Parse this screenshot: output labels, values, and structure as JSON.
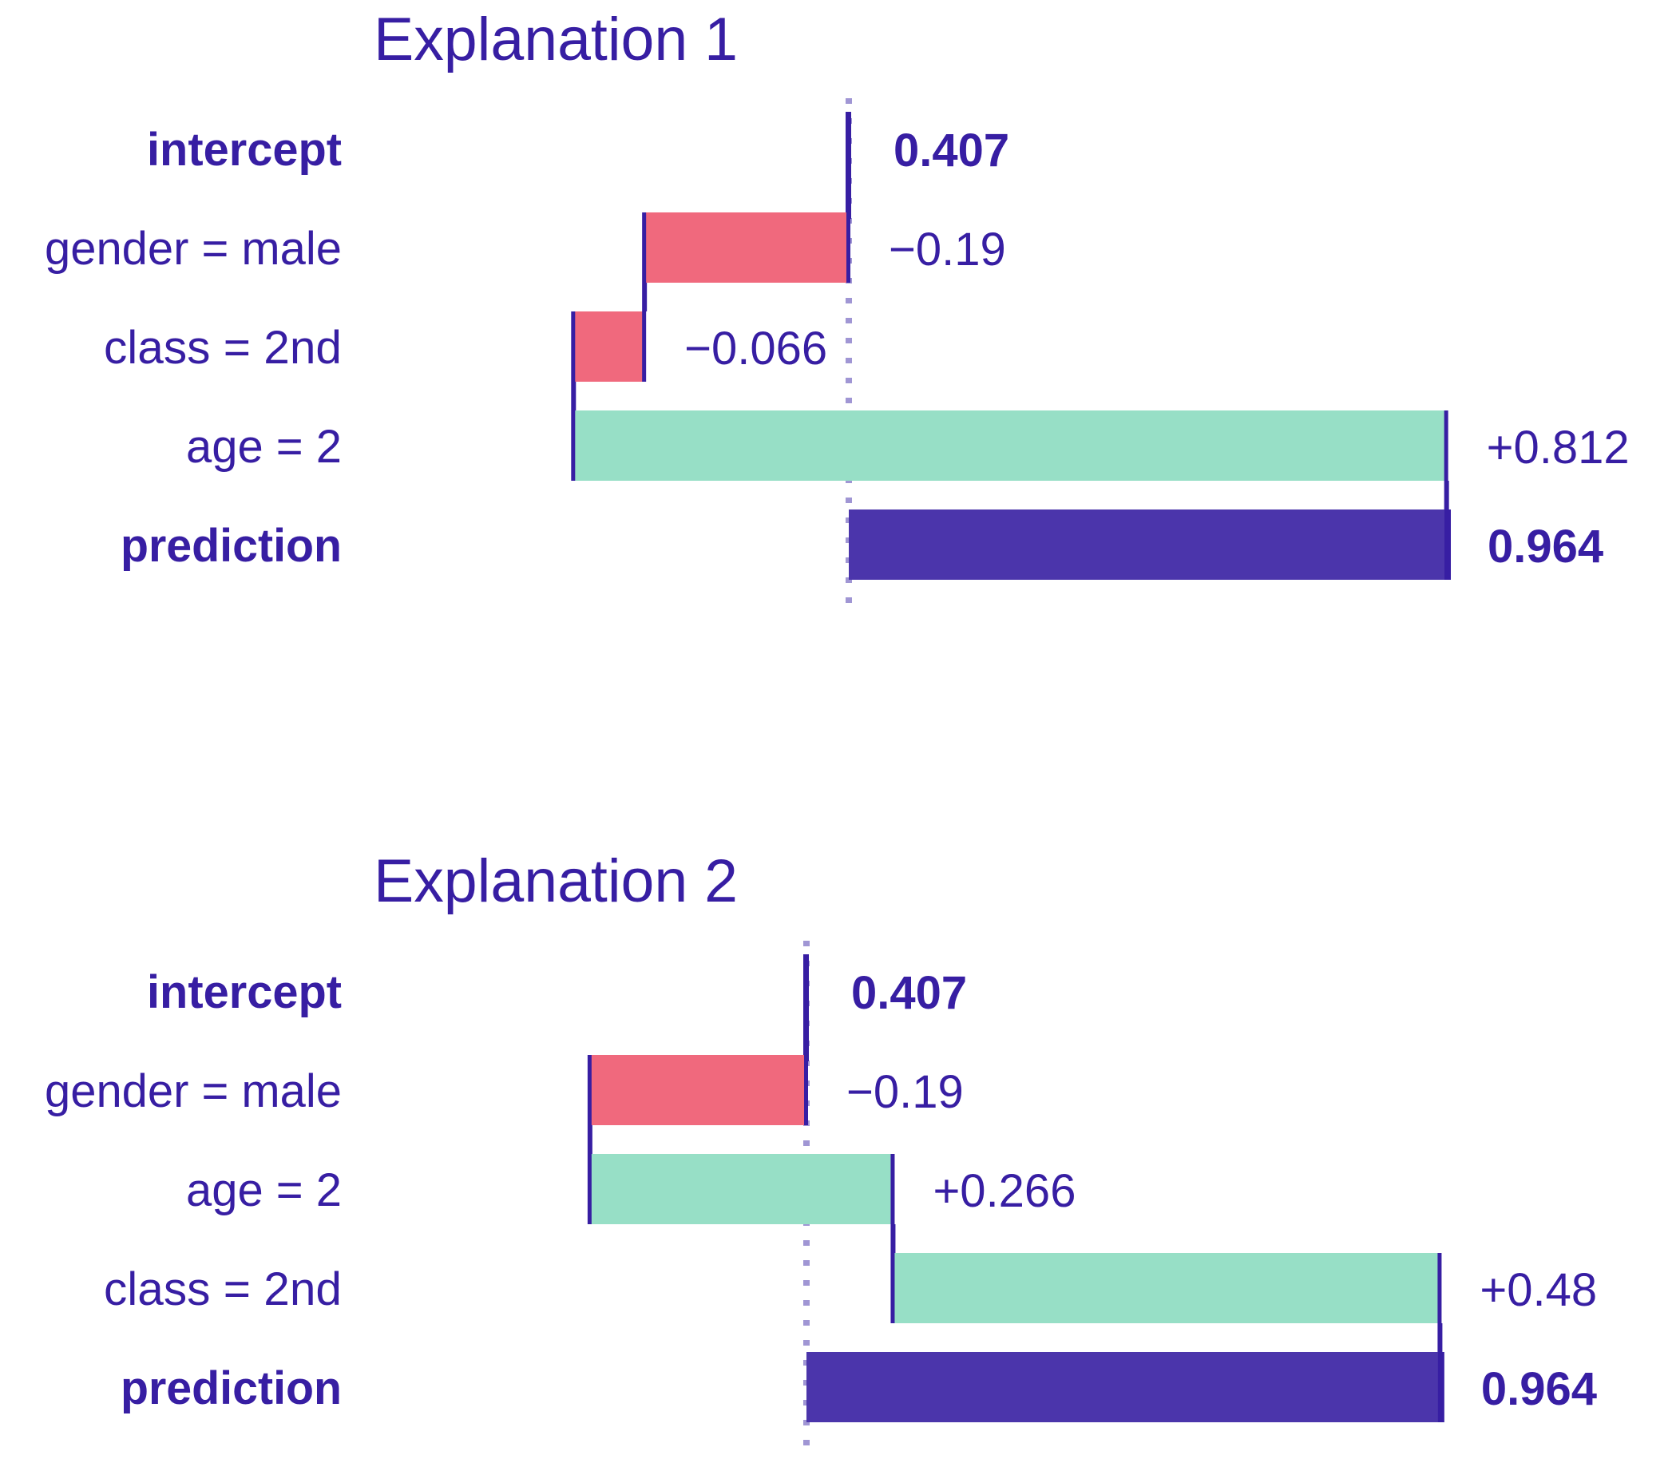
{
  "colors": {
    "text": "#371EA3",
    "negative": "#F0697D",
    "positive": "#97DFC6",
    "prediction": "#4B35AB",
    "connector": "#371EA3",
    "reference_line": "#A096D4"
  },
  "chart_data": [
    {
      "type": "waterfall-bar",
      "title": "Explanation 1",
      "xlabel": "",
      "ylabel": "",
      "grid": false,
      "reference_line": "intercept (dotted vertical)",
      "intercept": 0.407,
      "prediction": 0.964,
      "rows": [
        {
          "label": "intercept",
          "kind": "intercept",
          "value": 0.407,
          "value_label": "0.407"
        },
        {
          "label": "gender = male",
          "kind": "contribution",
          "value": -0.19,
          "value_label": "−0.19"
        },
        {
          "label": "class = 2nd",
          "kind": "contribution",
          "value": -0.066,
          "value_label": "−0.066"
        },
        {
          "label": "age = 2",
          "kind": "contribution",
          "value": 0.812,
          "value_label": "+0.812"
        },
        {
          "label": "prediction",
          "kind": "prediction",
          "value": 0.964,
          "value_label": "0.964"
        }
      ]
    },
    {
      "type": "waterfall-bar",
      "title": "Explanation 2",
      "xlabel": "",
      "ylabel": "",
      "grid": false,
      "reference_line": "intercept (dotted vertical)",
      "intercept": 0.407,
      "prediction": 0.964,
      "rows": [
        {
          "label": "intercept",
          "kind": "intercept",
          "value": 0.407,
          "value_label": "0.407"
        },
        {
          "label": "gender = male",
          "kind": "contribution",
          "value": -0.19,
          "value_label": "−0.19"
        },
        {
          "label": "age = 2",
          "kind": "contribution",
          "value": 0.266,
          "value_label": "+0.266"
        },
        {
          "label": "class = 2nd",
          "kind": "contribution",
          "value": 0.48,
          "value_label": "+0.48"
        },
        {
          "label": "prediction",
          "kind": "prediction",
          "value": 0.964,
          "value_label": "0.964"
        }
      ]
    }
  ]
}
